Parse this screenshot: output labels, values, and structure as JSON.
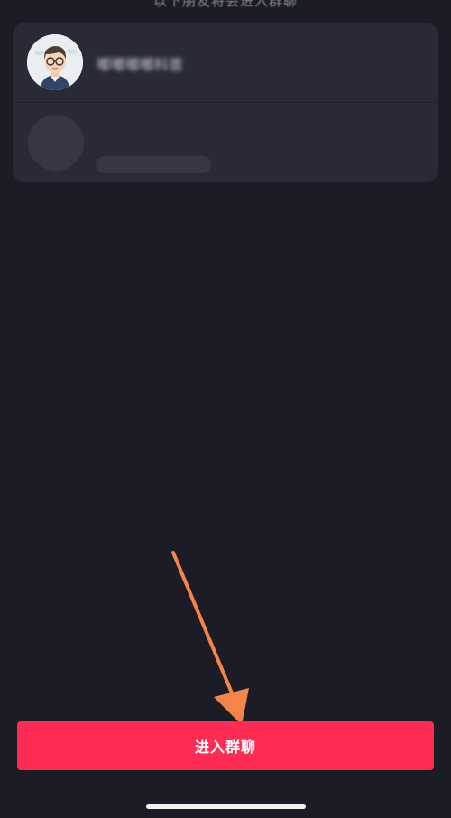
{
  "header": {
    "hint_text": "以下朋友将会进入群聊"
  },
  "members": [
    {
      "name": "嘟嘟嘟嘟科普",
      "avatar_icon": "cartoon-man-with-glasses"
    },
    {
      "name": "",
      "avatar_icon": "avatar-placeholder"
    }
  ],
  "actions": {
    "join_label": "进入群聊"
  },
  "colors": {
    "background": "#1b1c25",
    "card": "#292a35",
    "placeholder": "#363743",
    "accent": "#fe2c55",
    "annotation_arrow": "#f4844a"
  }
}
